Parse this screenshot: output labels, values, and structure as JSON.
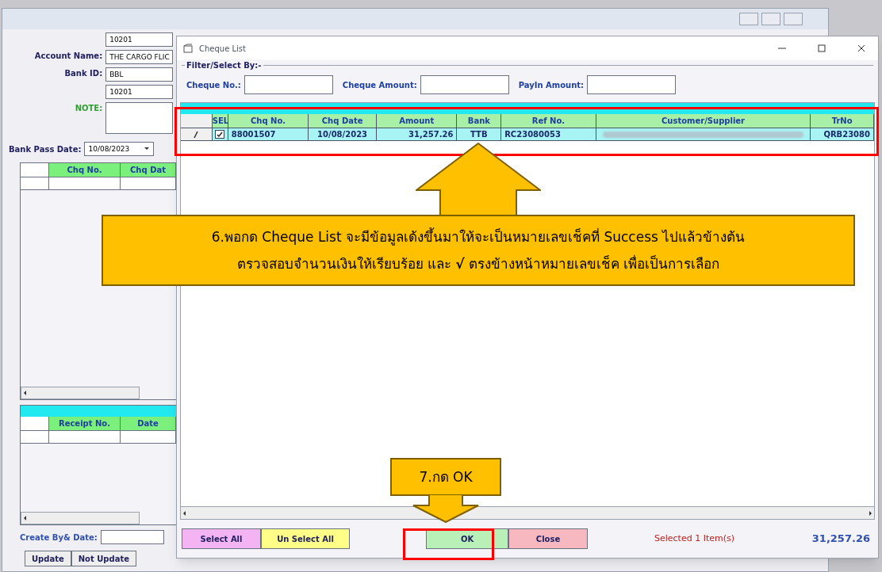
{
  "main_window": {
    "fields": [
      {
        "value": "10201"
      },
      {
        "label": "Account Name:",
        "value": "THE CARGO FLIC"
      },
      {
        "label": "Bank ID:",
        "value": "BBL"
      },
      {
        "value": "10201"
      },
      {
        "label": "NOTE:",
        "kind": "memo"
      }
    ],
    "pass_date": {
      "label": "Bank Pass Date:",
      "value": "10/08/2023"
    },
    "cheque_grid": {
      "columns": [
        "Chq No.",
        "Chq Dat"
      ]
    },
    "receipt_grid": {
      "columns": [
        "Receipt No.",
        "Date"
      ]
    },
    "create_by": {
      "label": "Create By& Date:"
    },
    "buttons": [
      "Update",
      "Not Update"
    ]
  },
  "dialog": {
    "title": "Cheque List",
    "filter_legend": "Filter/Select By:-",
    "filters": [
      {
        "label": "Cheque No.:"
      },
      {
        "label": "Cheque Amount:"
      },
      {
        "label": "PayIn Amount:"
      }
    ],
    "table": {
      "select_column": "SEL",
      "columns": [
        "Chq No.",
        "Chq Date",
        "Amount",
        "Bank",
        "Ref No.",
        "Customer/Supplier",
        "TrNo"
      ],
      "rows": [
        {
          "checked": true,
          "cells": [
            "88001507",
            "10/08/2023",
            "31,257.26",
            "TTB",
            "RC23080053",
            "",
            "QRB23080"
          ]
        }
      ]
    },
    "buttons": [
      {
        "label": "Select All",
        "color": "#f4b4f4"
      },
      {
        "label": "Un Select All",
        "color": "#ffff88"
      },
      {
        "label": "OK",
        "color": "#b8f0b8"
      },
      {
        "label": "Close",
        "color": "#f8b8c0"
      }
    ],
    "status": "Selected 1 Item(s)",
    "total": "31,257.26"
  },
  "callouts": [
    {
      "kind": "up",
      "lines": [
        "6.พอกด Cheque List จะมีข้อมูลเด้งขึ้นมาให้จะเป็นหมายเลขเช็คที่ Success ไปแล้วข้างต้น",
        "ตรวจสอบจำนวนเงินให้เรียบร้อย และ **√** ตรงข้างหน้าหมายเลขเช็ค เพื่อเป็นการเลือก"
      ]
    },
    {
      "kind": "down",
      "lines": [
        "7.กด OK"
      ]
    }
  ]
}
